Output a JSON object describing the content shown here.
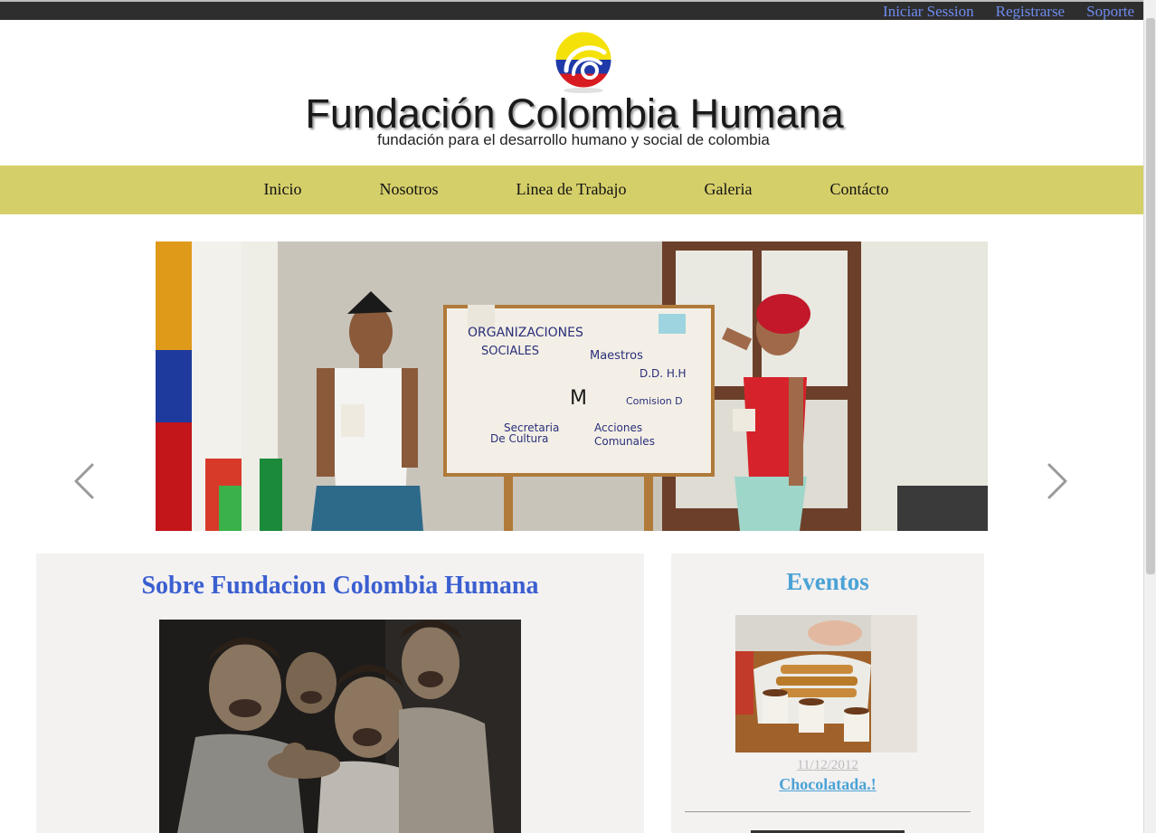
{
  "topbar": {
    "links": [
      "Iniciar Session",
      "Registrarse",
      "Soporte"
    ]
  },
  "header": {
    "title": "Fundación Colombia Humana",
    "tagline": "fundación para el desarrollo humano y social de colombia"
  },
  "nav": {
    "items": [
      "Inicio",
      "Nosotros",
      "Linea de Trabajo",
      "Galeria",
      "Contácto"
    ]
  },
  "about": {
    "heading": "Sobre Fundacion Colombia Humana"
  },
  "events": {
    "heading": "Eventos",
    "items": [
      {
        "date": "11/12/2012",
        "title": "Chocolatada.!"
      }
    ]
  },
  "colors": {
    "nav_bg": "#d5cf6a",
    "topbar_bg": "#2e2e2e",
    "link": "#6f8cf0",
    "about_heading": "#3a5fd0",
    "events_heading": "#4aa3d6",
    "panel_bg": "#f4f1f1"
  }
}
